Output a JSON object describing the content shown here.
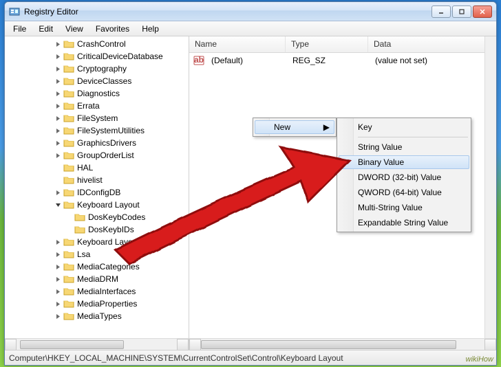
{
  "window": {
    "title": "Registry Editor"
  },
  "menubar": [
    "File",
    "Edit",
    "View",
    "Favorites",
    "Help"
  ],
  "tree": [
    {
      "depth": 3,
      "exp": "closed",
      "label": "CrashControl"
    },
    {
      "depth": 3,
      "exp": "closed",
      "label": "CriticalDeviceDatabase"
    },
    {
      "depth": 3,
      "exp": "closed",
      "label": "Cryptography"
    },
    {
      "depth": 3,
      "exp": "closed",
      "label": "DeviceClasses"
    },
    {
      "depth": 3,
      "exp": "closed",
      "label": "Diagnostics"
    },
    {
      "depth": 3,
      "exp": "closed",
      "label": "Errata"
    },
    {
      "depth": 3,
      "exp": "closed",
      "label": "FileSystem"
    },
    {
      "depth": 3,
      "exp": "closed",
      "label": "FileSystemUtilities"
    },
    {
      "depth": 3,
      "exp": "closed",
      "label": "GraphicsDrivers"
    },
    {
      "depth": 3,
      "exp": "closed",
      "label": "GroupOrderList"
    },
    {
      "depth": 3,
      "exp": "none",
      "label": "HAL"
    },
    {
      "depth": 3,
      "exp": "none",
      "label": "hivelist"
    },
    {
      "depth": 3,
      "exp": "closed",
      "label": "IDConfigDB"
    },
    {
      "depth": 3,
      "exp": "open",
      "label": "Keyboard Layout"
    },
    {
      "depth": 4,
      "exp": "none",
      "label": "DosKeybCodes"
    },
    {
      "depth": 4,
      "exp": "none",
      "label": "DosKeybIDs"
    },
    {
      "depth": 3,
      "exp": "closed",
      "label": "Keyboard Layouts"
    },
    {
      "depth": 3,
      "exp": "closed",
      "label": "Lsa"
    },
    {
      "depth": 3,
      "exp": "closed",
      "label": "MediaCategories"
    },
    {
      "depth": 3,
      "exp": "closed",
      "label": "MediaDRM"
    },
    {
      "depth": 3,
      "exp": "closed",
      "label": "MediaInterfaces"
    },
    {
      "depth": 3,
      "exp": "closed",
      "label": "MediaProperties"
    },
    {
      "depth": 3,
      "exp": "closed",
      "label": "MediaTypes"
    }
  ],
  "list": {
    "headers": {
      "name": "Name",
      "type": "Type",
      "data": "Data"
    },
    "rows": [
      {
        "name": "(Default)",
        "type": "REG_SZ",
        "data": "(value not set)"
      }
    ]
  },
  "context_parent": {
    "new_label": "New"
  },
  "context_sub": [
    {
      "label": "Key",
      "hl": false
    },
    {
      "sep": true
    },
    {
      "label": "String Value",
      "hl": false
    },
    {
      "label": "Binary Value",
      "hl": true
    },
    {
      "label": "DWORD (32-bit) Value",
      "hl": false
    },
    {
      "label": "QWORD (64-bit) Value",
      "hl": false
    },
    {
      "label": "Multi-String Value",
      "hl": false
    },
    {
      "label": "Expandable String Value",
      "hl": false
    }
  ],
  "statusbar": "Computer\\HKEY_LOCAL_MACHINE\\SYSTEM\\CurrentControlSet\\Control\\Keyboard Layout",
  "watermark": "wikiHow"
}
